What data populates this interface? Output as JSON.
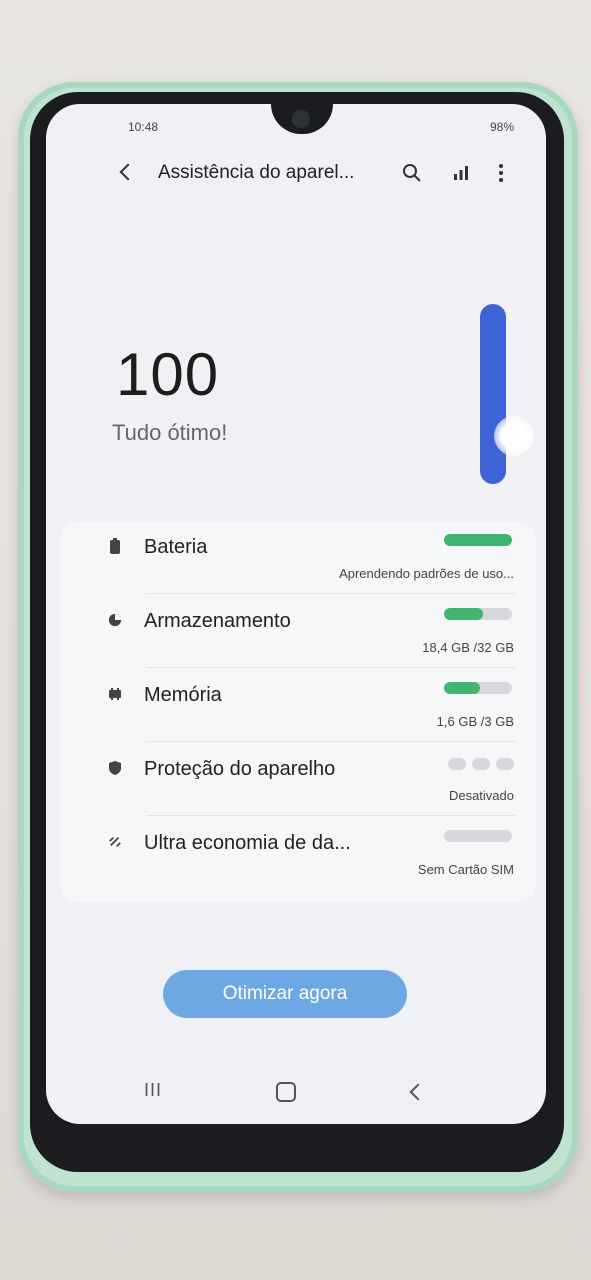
{
  "status_bar": {
    "time": "10:48",
    "battery": "98%"
  },
  "header": {
    "title": "Assistência do aparel..."
  },
  "score": {
    "value": "100",
    "status": "Tudo ótimo!"
  },
  "items": [
    {
      "label": "Bateria",
      "value": "Aprendendo padrões de uso...",
      "level": 1.0
    },
    {
      "label": "Armazenamento",
      "value": "18,4 GB /32 GB",
      "level": 0.575
    },
    {
      "label": "Memória",
      "value": "1,6 GB /3 GB",
      "level": 0.53
    },
    {
      "label": "Proteção do aparelho",
      "value": "Desativado"
    },
    {
      "label": "Ultra economia de da...",
      "value": "Sem Cartão SIM",
      "level": 0.0
    }
  ],
  "button": {
    "optimize_label": "Otimizar agora"
  },
  "colors": {
    "accent": "#3e63d6",
    "bar_fill": "#3fb570",
    "button": "#6ea8e4"
  },
  "icons": [
    "search-icon",
    "chart-icon",
    "more-icon",
    "battery-icon",
    "storage-icon",
    "memory-icon",
    "shield-icon",
    "data-saver-icon"
  ]
}
